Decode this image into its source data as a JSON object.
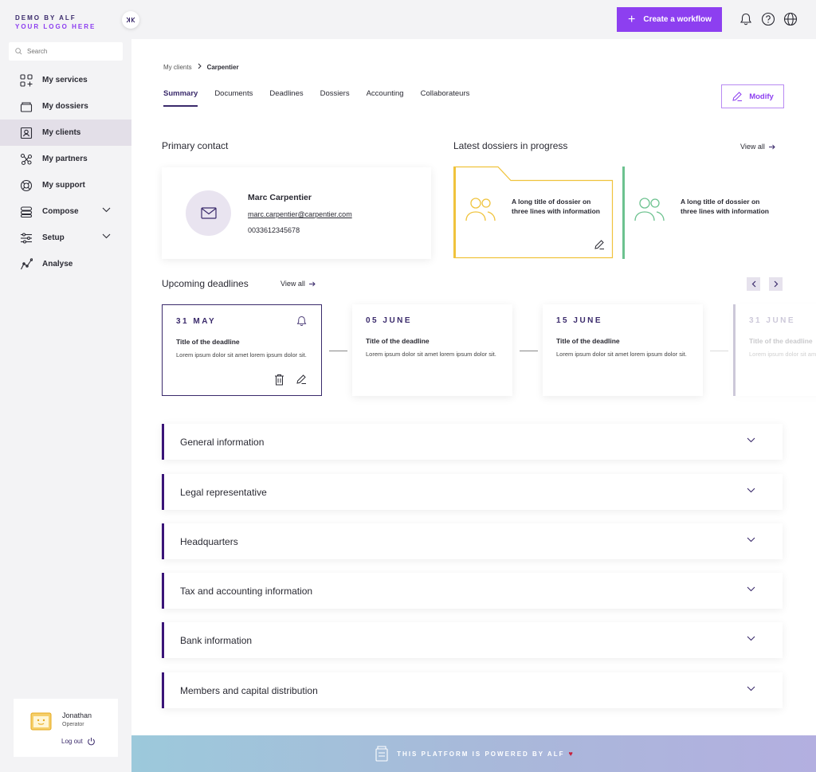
{
  "brand": {
    "line1": "DEMO BY ALF",
    "line2": "YOUR LOGO HERE"
  },
  "search": {
    "placeholder": "Search"
  },
  "sidebar": {
    "items": [
      {
        "label": "My services",
        "icon": "grid-plus-icon"
      },
      {
        "label": "My dossiers",
        "icon": "folder-box-icon"
      },
      {
        "label": "My clients",
        "icon": "contact-card-icon",
        "active": true
      },
      {
        "label": "My partners",
        "icon": "network-icon"
      },
      {
        "label": "My support",
        "icon": "lifebuoy-icon"
      },
      {
        "label": "Compose",
        "icon": "layers-icon",
        "expandable": true
      },
      {
        "label": "Setup",
        "icon": "sliders-icon",
        "expandable": true
      },
      {
        "label": "Analyse",
        "icon": "line-chart-icon"
      }
    ]
  },
  "user": {
    "name": "Jonathan",
    "role": "Operator",
    "logout": "Log out"
  },
  "topbar": {
    "create_label": "Create a workflow"
  },
  "breadcrumb": {
    "parent": "My clients",
    "current": "Carpentier"
  },
  "tabs": [
    "Summary",
    "Documents",
    "Deadlines",
    "Dossiers",
    "Accounting",
    "Collaborateurs"
  ],
  "modify_label": "Modify",
  "primary_contact": {
    "title": "Primary contact",
    "name": "Marc Carpentier",
    "email": "marc.carpentier@carpentier.com",
    "phone": "0033612345678"
  },
  "dossiers": {
    "title": "Latest dossiers in progress",
    "view_all": "View all",
    "items": [
      {
        "title": "A long title of dossier on three lines with information",
        "color": "#f0c33c"
      },
      {
        "title": "A long title of dossier on three lines with information",
        "color": "#6cc28f"
      }
    ]
  },
  "deadlines": {
    "title": "Upcoming deadlines",
    "view_all": "View all",
    "items": [
      {
        "date": "31 MAY",
        "title": "Title of the deadline",
        "desc": "Lorem ipsum dolor sit amet lorem ipsum dolor sit."
      },
      {
        "date": "05 JUNE",
        "title": "Title of the deadline",
        "desc": "Lorem ipsum dolor sit amet lorem ipsum dolor sit."
      },
      {
        "date": "15 JUNE",
        "title": "Title of the deadline",
        "desc": "Lorem ipsum dolor sit amet lorem ipsum dolor sit."
      },
      {
        "date": "31 JUNE",
        "title": "Title of the deadline",
        "desc": "Lorem ipsum dolor sit amet lorem ipsum dolor sit."
      }
    ]
  },
  "accordions": [
    "General information",
    "Legal representative",
    "Headquarters",
    "Tax and accounting information",
    "Bank information",
    "Members and capital distribution"
  ],
  "footer": {
    "text": "THIS PLATFORM IS POWERED BY ALF",
    "heart": "♥"
  },
  "colors": {
    "accent": "#8d3ff0",
    "primary": "#3a2a6b",
    "accordion_bar": "#3a1478"
  }
}
